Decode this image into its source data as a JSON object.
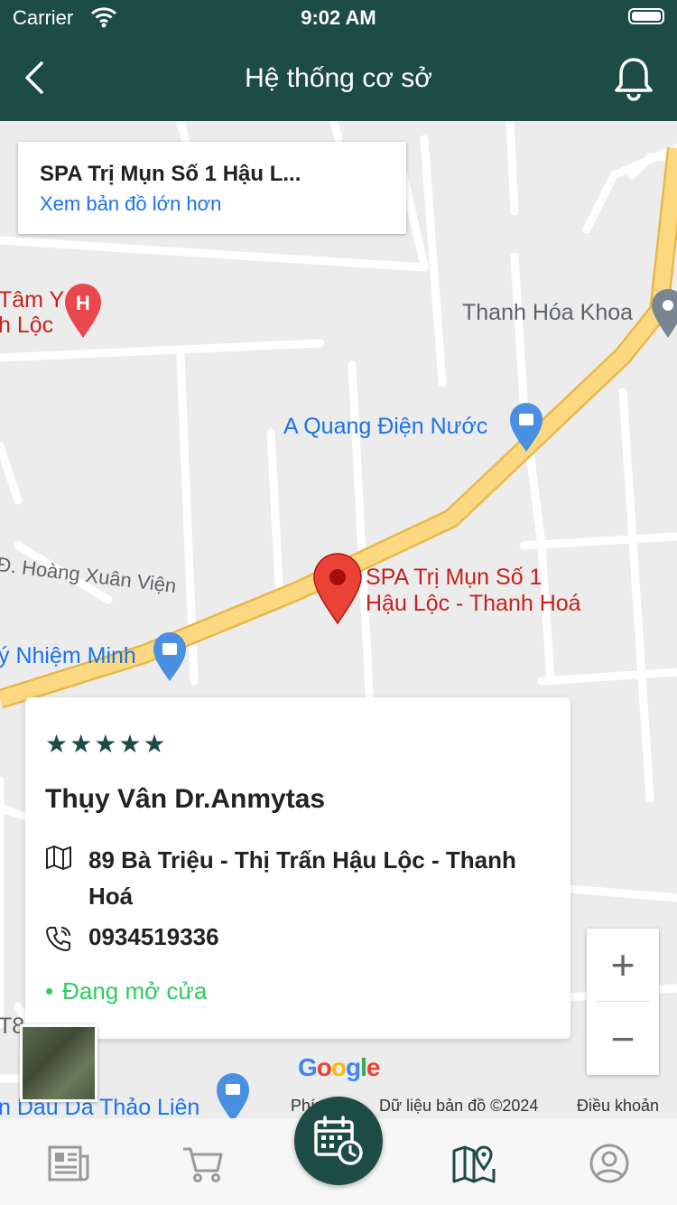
{
  "status_bar": {
    "carrier": "Carrier",
    "time": "9:02 AM"
  },
  "nav": {
    "title": "Hệ thống cơ sở"
  },
  "map": {
    "info_card": {
      "name": "SPA Trị Mụn Số 1 Hậu L...",
      "link": "Xem bản đồ lớn hơn"
    },
    "pois": {
      "tam_y_1": "Tâm Y",
      "tam_y_2": "h Lộc",
      "thanh_hoa": "Thanh Hóa Khoa",
      "a_quang": "A Quang Điện Nước",
      "hoang_xuan_vien": "Đ. Hoàng Xuân Viện",
      "nhiem_minh": "ý Nhiệm Minh",
      "spa_1": "SPA Trị Mụn Số 1",
      "spa_2": "Hậu Lộc - Thanh Hoá",
      "t8": "T8",
      "thao_lien": "n Dầu Da Thảo Liên"
    },
    "attribution": {
      "phim": "Phím",
      "data": "Dữ liệu bản đồ ©2024",
      "terms": "Điều khoản"
    },
    "zoom_in": "+",
    "zoom_out": "−"
  },
  "detail": {
    "rating": 5,
    "stars": [
      "★",
      "★",
      "★",
      "★",
      "★"
    ],
    "name": "Thụy Vân Dr.Anmytas",
    "address": "89 Bà Triệu - Thị Trấn Hậu Lộc - Thanh Hoá",
    "phone": "0934519336",
    "status": "Đang mở cửa"
  },
  "colors": {
    "primary": "#1d4b45",
    "open": "#2ecc5e",
    "link": "#1a73e8"
  },
  "tabs": [
    "news-icon",
    "cart-icon",
    "calendar-clock-icon",
    "map-icon",
    "profile-icon"
  ]
}
